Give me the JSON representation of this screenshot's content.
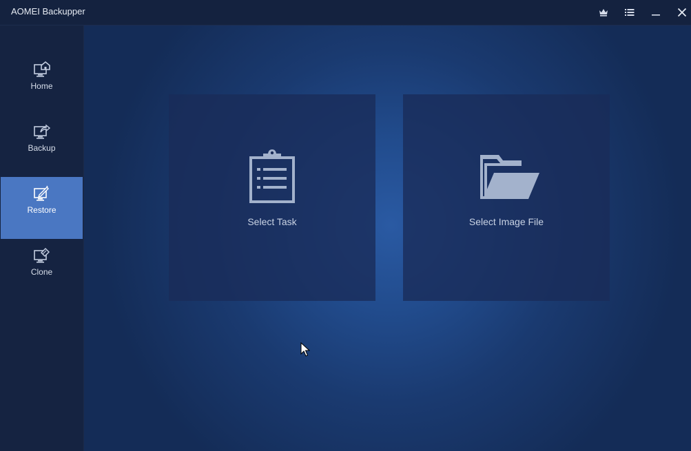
{
  "app": {
    "title": "AOMEI Backupper"
  },
  "titlebar": {
    "buttons": [
      "upgrade-crown",
      "menu-list",
      "minimize",
      "close"
    ]
  },
  "sidebar": {
    "items": [
      {
        "label": "Home",
        "icon": "home-monitor-icon",
        "active": false
      },
      {
        "label": "Backup",
        "icon": "backup-monitor-icon",
        "active": false
      },
      {
        "label": "Restore",
        "icon": "restore-monitor-icon",
        "active": true
      },
      {
        "label": "Clone",
        "icon": "clone-monitor-icon",
        "active": false
      }
    ]
  },
  "main": {
    "cards": [
      {
        "label": "Select Task",
        "icon": "clipboard-list-icon"
      },
      {
        "label": "Select Image File",
        "icon": "folder-open-icon"
      }
    ]
  },
  "colors": {
    "background": "#132244",
    "sidebar_active": "#4a77c2",
    "card": "#1a2c58",
    "icon": "#9fb0cb"
  }
}
